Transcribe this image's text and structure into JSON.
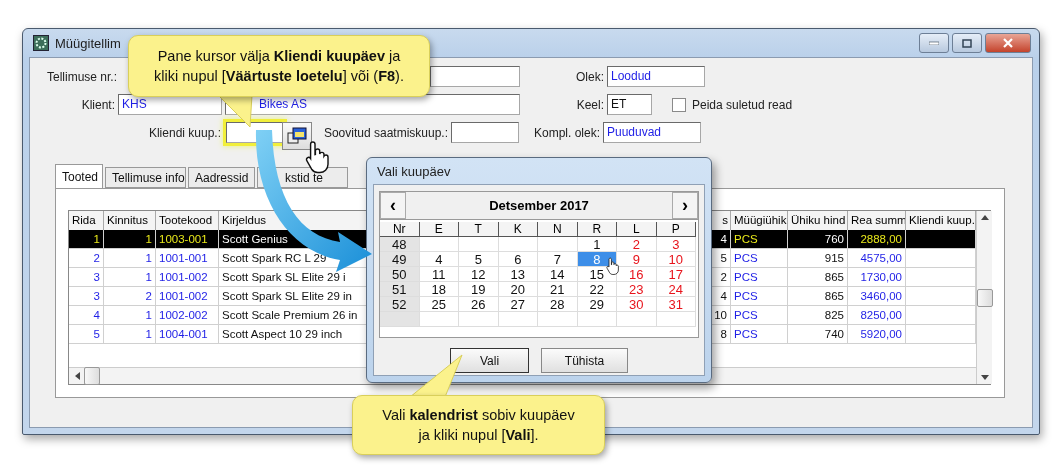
{
  "window": {
    "title": "Müügitellim"
  },
  "form": {
    "order_no": {
      "label": "Tellimuse nr.:"
    },
    "client": {
      "label": "Klient:",
      "code": "KHS",
      "name": "Bikes AS"
    },
    "client_date": {
      "label": "Kliendi kuup.:"
    },
    "ship_date": {
      "label": "Soovitud saatmiskuup.:"
    },
    "status": {
      "label": "Olek:",
      "value": "Loodud"
    },
    "language": {
      "label": "Keel:",
      "value": "ET"
    },
    "hide_closed": {
      "label": "Peida suletud read",
      "checked": false
    },
    "completion": {
      "label": "Kompl. olek:",
      "value": "Puuduvad"
    }
  },
  "tabs": [
    {
      "label": "Tooted",
      "selected": true
    },
    {
      "label": "Tellimuse info",
      "selected": false
    },
    {
      "label": "Aadressid",
      "selected": false
    },
    {
      "label": "kstid te",
      "selected": false
    }
  ],
  "table": {
    "columns": [
      {
        "label": "Rida",
        "kind": "key"
      },
      {
        "label": "Kinnitus",
        "kind": "key"
      },
      {
        "label": "Tootekood",
        "kind": "code"
      },
      {
        "label": "Kirjeldus",
        "kind": "text"
      },
      {
        "label": "s",
        "kind": "number"
      },
      {
        "label": "Müügiühik",
        "kind": "code"
      },
      {
        "label": "Ühiku hind",
        "kind": "number"
      },
      {
        "label": "Rea summ",
        "kind": "amount"
      },
      {
        "label": "Kliendi kuup.",
        "kind": "text"
      }
    ],
    "rows": [
      {
        "selected": true,
        "cells": [
          "1",
          "1",
          "1003-001",
          "Scott Genius",
          "4",
          "PCS",
          "760",
          "2888,00",
          null
        ]
      },
      {
        "selected": false,
        "cells": [
          "2",
          "1",
          "1001-001",
          "Scott Spark RC L 29",
          "5",
          "PCS",
          "915",
          "4575,00",
          null
        ]
      },
      {
        "selected": false,
        "cells": [
          "3",
          "1",
          "1001-002",
          "Scott Spark SL Elite 29 i",
          "2",
          "PCS",
          "865",
          "1730,00",
          null
        ]
      },
      {
        "selected": false,
        "cells": [
          "3",
          "2",
          "1001-002",
          "Scott Spark SL Elite 29 in",
          "4",
          "PCS",
          "865",
          "3460,00",
          null
        ]
      },
      {
        "selected": false,
        "cells": [
          "4",
          "1",
          "1002-002",
          "Scott Scale Premium 26 in",
          "10",
          "PCS",
          "825",
          "8250,00",
          null
        ]
      },
      {
        "selected": false,
        "cells": [
          "5",
          "1",
          "1004-001",
          "Scott Aspect 10 29 inch",
          "8",
          "PCS",
          "740",
          "5920,00",
          null
        ]
      }
    ]
  },
  "date_dialog": {
    "title": "Vali kuupäev",
    "prev": "‹",
    "next": "›",
    "month": "Detsember 2017",
    "headers": [
      "Nr",
      "E",
      "T",
      "K",
      "N",
      "R",
      "L",
      "P"
    ],
    "weeks": [
      {
        "nr": "48",
        "days": [
          {
            "day": "1",
            "selected": false,
            "weekend": false
          },
          {
            "day": "2",
            "selected": false,
            "weekend": true
          },
          {
            "day": "3",
            "selected": false,
            "weekend": true
          }
        ]
      },
      {
        "nr": "49",
        "days": [
          {
            "day": "4",
            "selected": false,
            "weekend": false
          },
          {
            "day": "5",
            "selected": false,
            "weekend": false
          },
          {
            "day": "6",
            "selected": false,
            "weekend": false
          },
          {
            "day": "7",
            "selected": false,
            "weekend": false
          },
          {
            "day": "8",
            "selected": true,
            "weekend": false
          },
          {
            "day": "9",
            "selected": false,
            "weekend": true
          },
          {
            "day": "10",
            "selected": false,
            "weekend": true
          }
        ]
      },
      {
        "nr": "50",
        "days": [
          {
            "day": "11",
            "selected": false,
            "weekend": false
          },
          {
            "day": "12",
            "selected": false,
            "weekend": false
          },
          {
            "day": "13",
            "selected": false,
            "weekend": false
          },
          {
            "day": "14",
            "selected": false,
            "weekend": false
          },
          {
            "day": "15",
            "selected": false,
            "weekend": false
          },
          {
            "day": "16",
            "selected": false,
            "weekend": true
          },
          {
            "day": "17",
            "selected": false,
            "weekend": true
          }
        ]
      },
      {
        "nr": "51",
        "days": [
          {
            "day": "18",
            "selected": false,
            "weekend": false
          },
          {
            "day": "19",
            "selected": false,
            "weekend": false
          },
          {
            "day": "20",
            "selected": false,
            "weekend": false
          },
          {
            "day": "21",
            "selected": false,
            "weekend": false
          },
          {
            "day": "22",
            "selected": false,
            "weekend": false
          },
          {
            "day": "23",
            "selected": false,
            "weekend": true
          },
          {
            "day": "24",
            "selected": false,
            "weekend": true
          }
        ]
      },
      {
        "nr": "52",
        "days": [
          {
            "day": "25",
            "selected": false,
            "weekend": false
          },
          {
            "day": "26",
            "selected": false,
            "weekend": false
          },
          {
            "day": "27",
            "selected": false,
            "weekend": false
          },
          {
            "day": "28",
            "selected": false,
            "weekend": false
          },
          {
            "day": "29",
            "selected": false,
            "weekend": false
          },
          {
            "day": "30",
            "selected": false,
            "weekend": true
          },
          {
            "day": "31",
            "selected": false,
            "weekend": true
          }
        ]
      }
    ],
    "buttons": [
      "Vali",
      "Tühista"
    ]
  },
  "callouts": [
    {
      "lines": [
        "Pane kursor välja **Kliendi kuupäev** ja",
        "kliki nupul [**Väärtuste loetelu**] või (**F8**)."
      ]
    },
    {
      "lines": [
        "Vali **kalendrist** sobiv kuupäev",
        "ja kliki nupul [**Vali**]."
      ]
    }
  ]
}
